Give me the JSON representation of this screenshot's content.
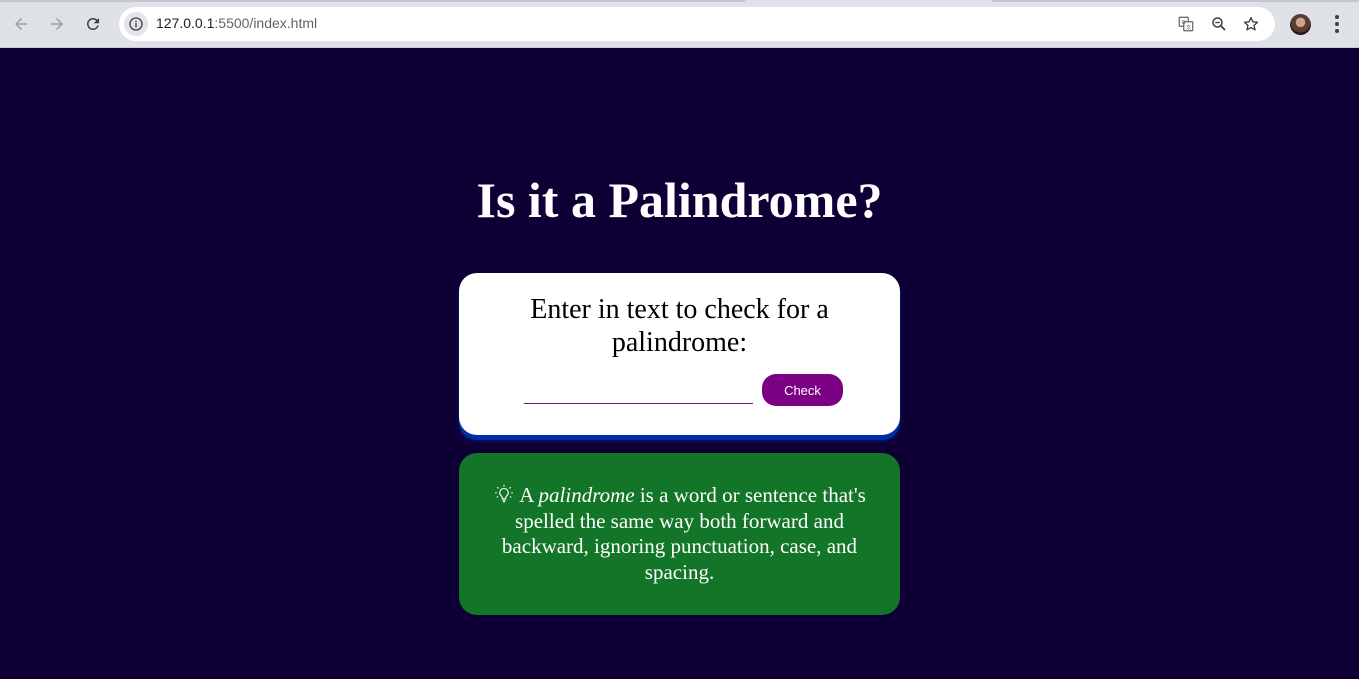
{
  "browser": {
    "url_host": "127.0.0.1",
    "url_rest": ":5500/index.html",
    "icons": [
      "back-arrow-icon",
      "forward-arrow-icon",
      "reload-icon",
      "site-info-icon",
      "translate-icon",
      "zoom-icon",
      "bookmark-star-icon",
      "profile-avatar",
      "menu-dots-icon"
    ]
  },
  "page": {
    "title": "Is it a Palindrome?",
    "card": {
      "label": "Enter in text to check for a palindrome:",
      "input_value": "",
      "button_label": "Check"
    },
    "info": {
      "icon": "lightbulb-icon",
      "prefix": "A",
      "term": "palindrome",
      "suffix": "is a word or sentence that's spelled the same way both forward and backward, ignoring punctuation, case, and spacing."
    },
    "colors": {
      "background": "#0e0035",
      "card": "#ffffff",
      "button": "#7b0084",
      "info_box": "#127528",
      "card_shadow": "#002ea8"
    }
  }
}
